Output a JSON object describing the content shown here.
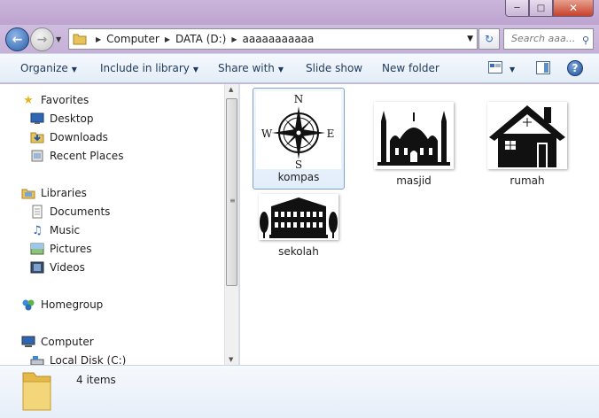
{
  "window": {
    "min_icon": "minimize-icon",
    "max_icon": "maximize-icon",
    "close_icon": "close-icon"
  },
  "address": {
    "crumbs": [
      "Computer",
      "DATA (D:)",
      "aaaaaaaaaaa"
    ]
  },
  "search": {
    "placeholder": "Search aaa..."
  },
  "toolbar": {
    "organize": "Organize",
    "include": "Include in library",
    "share": "Share with",
    "slideshow": "Slide show",
    "newfolder": "New folder",
    "help": "?"
  },
  "nav": {
    "favorites": "Favorites",
    "desktop": "Desktop",
    "downloads": "Downloads",
    "recent": "Recent Places",
    "libraries": "Libraries",
    "documents": "Documents",
    "music": "Music",
    "pictures": "Pictures",
    "videos": "Videos",
    "homegroup": "Homegroup",
    "computer": "Computer",
    "localdisk": "Local Disk (C:)"
  },
  "files": [
    "kompas",
    "masjid",
    "rumah",
    "sekolah"
  ],
  "compass_letters": {
    "n": "N",
    "s": "S",
    "e": "E",
    "w": "W"
  },
  "status": {
    "count": "4 items"
  },
  "colors": {
    "accent": "#2c5ea8",
    "selection": "#7da2ce"
  }
}
